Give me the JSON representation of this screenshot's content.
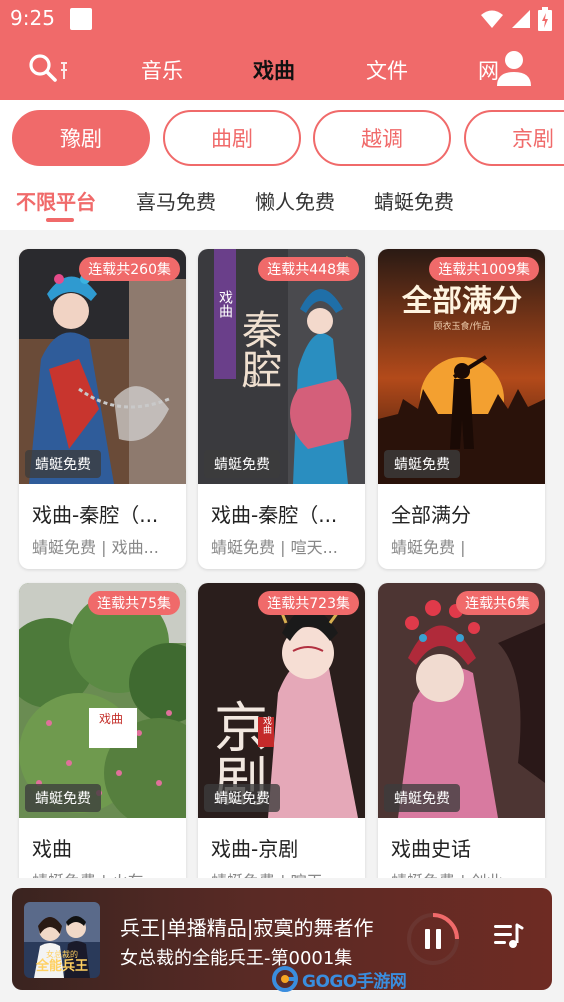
{
  "status": {
    "time": "9:25"
  },
  "nav": {
    "tabs": [
      {
        "label": "音乐",
        "active": false
      },
      {
        "label": "戏曲",
        "active": true
      },
      {
        "label": "文件",
        "active": false
      },
      {
        "label": "网",
        "active": false
      }
    ]
  },
  "categories": [
    {
      "label": "豫剧",
      "active": true
    },
    {
      "label": "曲剧",
      "active": false
    },
    {
      "label": "越调",
      "active": false
    },
    {
      "label": "京剧",
      "active": false
    }
  ],
  "platforms": [
    {
      "label": "不限平台",
      "active": true
    },
    {
      "label": "喜马免费",
      "active": false
    },
    {
      "label": "懒人免费",
      "active": false
    },
    {
      "label": "蜻蜓免费",
      "active": false
    }
  ],
  "cards": [
    {
      "badge": "连载共260集",
      "source": "蜻蜓免费",
      "title": "戏曲-秦腔（...",
      "subtitle": "蜻蜓免费 | 戏曲..."
    },
    {
      "badge": "连载共448集",
      "source": "蜻蜓免费",
      "title": "戏曲-秦腔（...",
      "subtitle": "蜻蜓免费 | 喧天..."
    },
    {
      "badge": "连载共1009集",
      "source": "蜻蜓免费",
      "title": "全部满分",
      "subtitle": "蜻蜓免费 |"
    },
    {
      "badge": "连载共75集",
      "source": "蜻蜓免费",
      "title": "戏曲",
      "subtitle": "蜻蜓免费 | 火车"
    },
    {
      "badge": "连载共723集",
      "source": "蜻蜓免费",
      "title": "戏曲-京剧",
      "subtitle": "蜻蜓免费 | 喧天"
    },
    {
      "badge": "连载共6集",
      "source": "蜻蜓免费",
      "title": "戏曲史话",
      "subtitle": "蜻蜓免费 | 创业"
    }
  ],
  "cover_text": {
    "c2_side": "戏曲",
    "c2_big": "秦腔",
    "c2_num": "1",
    "c3_big": "全部满分",
    "c3_small": "顾衣玉食/作品",
    "c4_label": "戏曲",
    "c5_big": "京剧",
    "c5_seal": "戏曲"
  },
  "player": {
    "line1": "兵王|单播精品|寂寞的舞者作",
    "line2": "女总裁的全能兵王-第0001集",
    "thumb_text": "全能兵王",
    "thumb_small": "女总裁的"
  },
  "watermark": {
    "text": "GOGO手游网"
  },
  "colors": {
    "accent": "#f06a6a",
    "player_bg": "#5a2a25"
  }
}
